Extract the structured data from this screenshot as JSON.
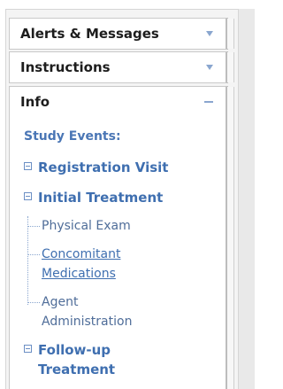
{
  "panels": {
    "alerts": {
      "title": "Alerts & Messages"
    },
    "instructions": {
      "title": "Instructions"
    },
    "info": {
      "title": "Info"
    }
  },
  "info": {
    "section_title": "Study Events:",
    "events": [
      {
        "label": "Registration Visit"
      },
      {
        "label": "Initial Treatment",
        "children": [
          "Physical Exam",
          "Concomitant Medications",
          "Agent Administration"
        ]
      },
      {
        "label": "Follow-up Treatment"
      }
    ]
  },
  "colors": {
    "link": "#3f6fb0",
    "panel_border": "#c9c9c9",
    "background": "#f4f4f4"
  }
}
